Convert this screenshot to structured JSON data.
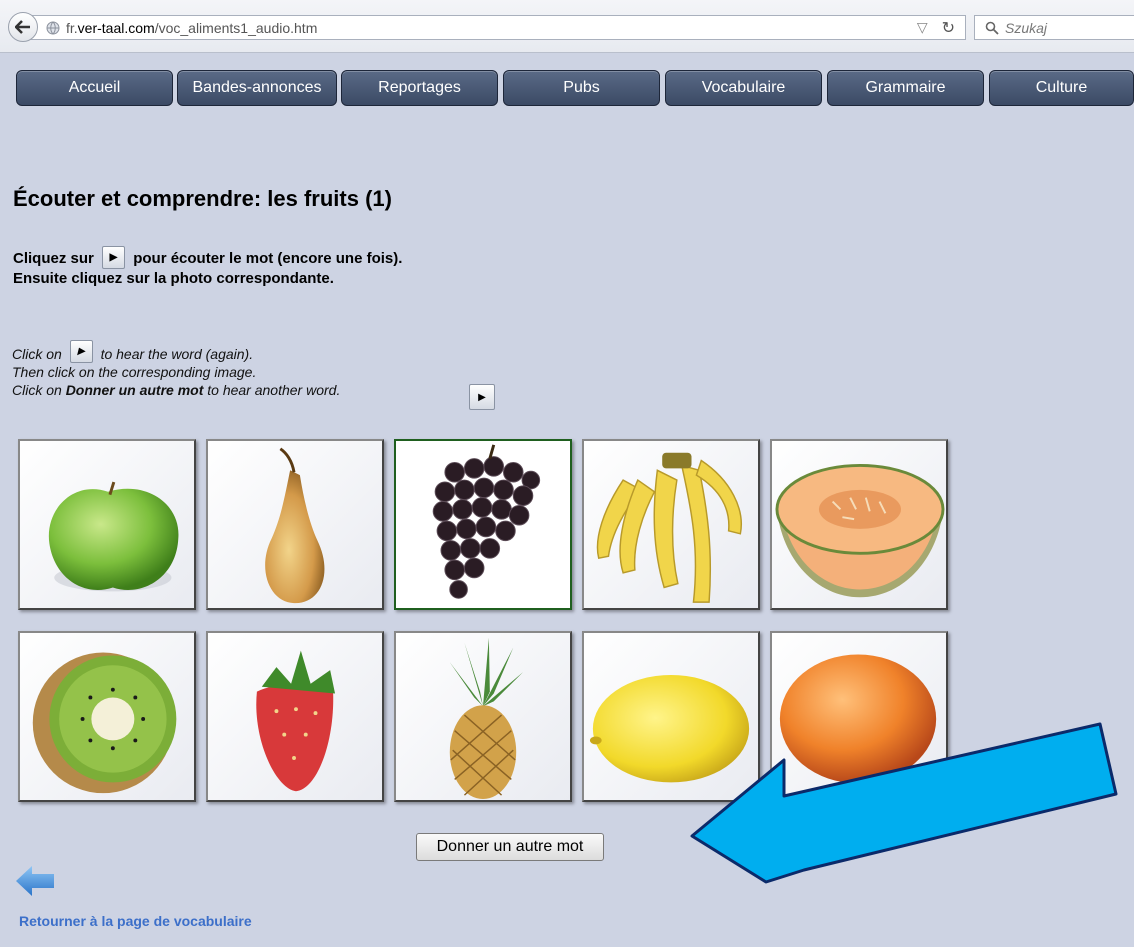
{
  "browser": {
    "url_prefix": "fr.",
    "url_host": "ver-taal.com",
    "url_path": "/voc_aliments1_audio.htm",
    "search_placeholder": "Szukaj"
  },
  "nav": {
    "items": [
      {
        "label": "Accueil"
      },
      {
        "label": "Bandes-annonces"
      },
      {
        "label": "Reportages"
      },
      {
        "label": "Pubs"
      },
      {
        "label": "Vocabulaire"
      },
      {
        "label": "Grammaire"
      },
      {
        "label": "Culture"
      }
    ]
  },
  "page": {
    "title": "Écouter et comprendre: les fruits (1)",
    "fr_line1_a": "Cliquez sur",
    "fr_line1_b": "pour écouter le mot (encore une fois).",
    "fr_line2": "Ensuite cliquez sur la photo correspondante.",
    "en_line1_a": "Click on",
    "en_line1_b": "to hear the word (again).",
    "en_line2": "Then click on the corresponding image.",
    "en_line3_a": "Click on",
    "en_line3_bold": "Donner un autre mot",
    "en_line3_b": "to hear another word."
  },
  "tiles": [
    {
      "fruit": "apple-image"
    },
    {
      "fruit": "pear-image"
    },
    {
      "fruit": "grapes-image",
      "selected": true
    },
    {
      "fruit": "bananas-image"
    },
    {
      "fruit": "melon-image"
    },
    {
      "fruit": "kiwi-image"
    },
    {
      "fruit": "strawberry-image"
    },
    {
      "fruit": "pineapple-image"
    },
    {
      "fruit": "lemon-image"
    },
    {
      "fruit": "orange-image"
    }
  ],
  "actions": {
    "another_word_label": "Donner un autre mot",
    "back_link_label": "Retourner à la page de vocabulaire"
  },
  "colors": {
    "background": "#cdd3e3",
    "nav": "#3b4a65",
    "link": "#3c6fc9",
    "annotation_arrow": "#00aeef"
  }
}
